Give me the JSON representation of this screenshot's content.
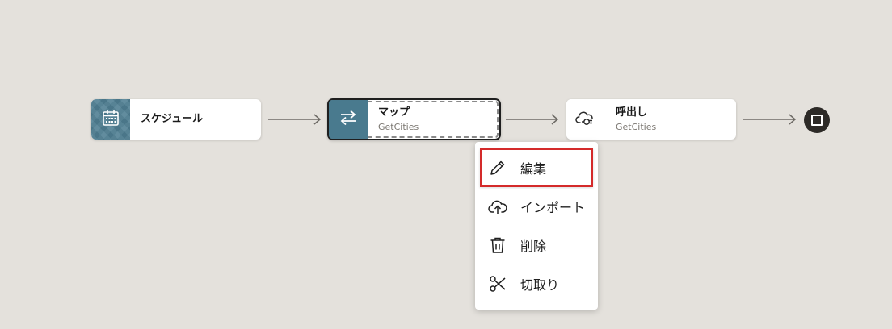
{
  "flow": {
    "nodes": [
      {
        "title": "スケジュール",
        "subtitle": "",
        "icon": "calendar-icon"
      },
      {
        "title": "マップ",
        "subtitle": "GetCities",
        "icon": "swap-arrows-icon"
      },
      {
        "title": "呼出し",
        "subtitle": "GetCities",
        "icon": "cloud-connect-icon"
      }
    ],
    "end_node": {
      "icon": "stop-square-icon"
    }
  },
  "context_menu": {
    "items": [
      {
        "label": "編集",
        "icon": "pencil-icon",
        "highlighted": true
      },
      {
        "label": "インポート",
        "icon": "cloud-upload-icon",
        "highlighted": false
      },
      {
        "label": "削除",
        "icon": "trash-icon",
        "highlighted": false
      },
      {
        "label": "切取り",
        "icon": "scissors-icon",
        "highlighted": false
      }
    ]
  },
  "colors": {
    "canvas_bg": "#e4e1dc",
    "node_accent": "#497a8e",
    "highlight_border": "#d42a2a",
    "end_node": "#2d2a27"
  }
}
